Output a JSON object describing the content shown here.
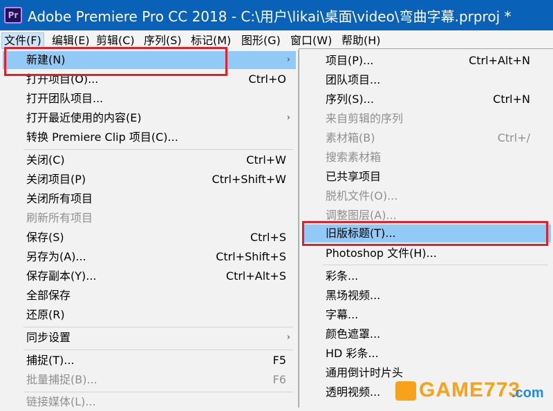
{
  "titlebar": {
    "icon_text": "Pr",
    "title": "Adobe Premiere Pro CC 2018 - C:\\用户\\likai\\桌面\\video\\弯曲字幕.prproj *"
  },
  "menubar": [
    "文件(F)",
    "编辑(E)",
    "剪辑(C)",
    "序列(S)",
    "标记(M)",
    "图形(G)",
    "窗口(W)",
    "帮助(H)"
  ],
  "file_menu": {
    "items": [
      {
        "label": "新建(N)",
        "shortcut": "",
        "submenu": true
      },
      {
        "label": "打开项目(O)...",
        "shortcut": "Ctrl+O"
      },
      {
        "label": "打开团队项目...",
        "shortcut": ""
      },
      {
        "label": "打开最近使用的内容(E)",
        "shortcut": "",
        "submenu": true
      },
      {
        "label": "转换 Premiere Clip 项目(C)...",
        "shortcut": ""
      },
      {
        "label": "关闭(C)",
        "shortcut": "Ctrl+W"
      },
      {
        "label": "关闭项目(P)",
        "shortcut": "Ctrl+Shift+W"
      },
      {
        "label": "关闭所有项目",
        "shortcut": ""
      },
      {
        "label": "刷新所有项目",
        "shortcut": "",
        "disabled": true
      },
      {
        "label": "保存(S)",
        "shortcut": "Ctrl+S"
      },
      {
        "label": "另存为(A)...",
        "shortcut": "Ctrl+Shift+S"
      },
      {
        "label": "保存副本(Y)...",
        "shortcut": "Ctrl+Alt+S"
      },
      {
        "label": "全部保存",
        "shortcut": ""
      },
      {
        "label": "还原(R)",
        "shortcut": ""
      },
      {
        "label": "同步设置",
        "shortcut": "",
        "submenu": true
      },
      {
        "label": "捕捉(T)...",
        "shortcut": "F5"
      },
      {
        "label": "批量捕捉(B)...",
        "shortcut": "F6",
        "disabled": true
      },
      {
        "label": "链接媒体(L)...",
        "shortcut": "",
        "disabled": true
      }
    ]
  },
  "new_submenu": {
    "items": [
      {
        "label": "项目(P)...",
        "shortcut": "Ctrl+Alt+N"
      },
      {
        "label": "团队项目...",
        "shortcut": ""
      },
      {
        "label": "序列(S)...",
        "shortcut": "Ctrl+N"
      },
      {
        "label": "来自剪辑的序列",
        "shortcut": "",
        "disabled": true
      },
      {
        "label": "素材箱(B)",
        "shortcut": "Ctrl+/",
        "disabled": true
      },
      {
        "label": "搜索素材箱",
        "shortcut": "",
        "disabled": true
      },
      {
        "label": "已共享项目",
        "shortcut": ""
      },
      {
        "label": "脱机文件(O)...",
        "shortcut": "",
        "disabled": true
      },
      {
        "label": "调整图层(A)...",
        "shortcut": "",
        "disabled": true
      },
      {
        "label": "旧版标题(T)...",
        "shortcut": ""
      },
      {
        "label": "Photoshop 文件(H)...",
        "shortcut": ""
      },
      {
        "label": "彩条...",
        "shortcut": ""
      },
      {
        "label": "黑场视频...",
        "shortcut": ""
      },
      {
        "label": "字幕...",
        "shortcut": ""
      },
      {
        "label": "颜色遮罩...",
        "shortcut": ""
      },
      {
        "label": "HD 彩条...",
        "shortcut": ""
      },
      {
        "label": "通用倒计时片头",
        "shortcut": ""
      },
      {
        "label": "透明视频...",
        "shortcut": ""
      }
    ]
  },
  "watermark": {
    "text": "GAME773",
    "suffix": ".com"
  },
  "colors": {
    "titlebar": "#0a62b8",
    "menu_bg": "#f2f2f2",
    "highlight": "#91c9f7",
    "annotation_red": "#e0212b",
    "disabled_text": "#8f8f8f"
  }
}
